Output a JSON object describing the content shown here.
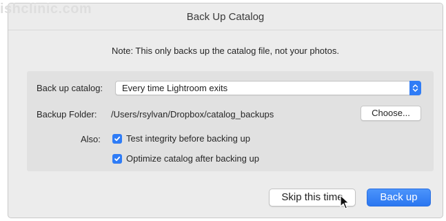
{
  "watermark": "ishclinic.com",
  "dialog": {
    "title": "Back Up Catalog",
    "note": "Note: This only backs up the catalog file, not your photos."
  },
  "settings": {
    "backup_catalog_label": "Back up catalog:",
    "backup_catalog_value": "Every time Lightroom exits",
    "backup_folder_label": "Backup Folder:",
    "backup_folder_path": "/Users/rsylvan/Dropbox/catalog_backups",
    "choose_label": "Choose...",
    "also_label": "Also:",
    "options": [
      {
        "label": "Test integrity before backing up",
        "checked": true
      },
      {
        "label": "Optimize catalog after backing up",
        "checked": true
      }
    ]
  },
  "buttons": {
    "skip_label": "Skip this time",
    "backup_label": "Back up"
  },
  "colors": {
    "accent": "#2f7cf6",
    "dialog_bg": "#ececec",
    "panel_bg": "#e1e1e1"
  },
  "icons": {
    "select_arrows": "up-down-chevron-icon",
    "checkbox": "checkmark-icon",
    "cursor": "mouse-pointer-icon"
  }
}
